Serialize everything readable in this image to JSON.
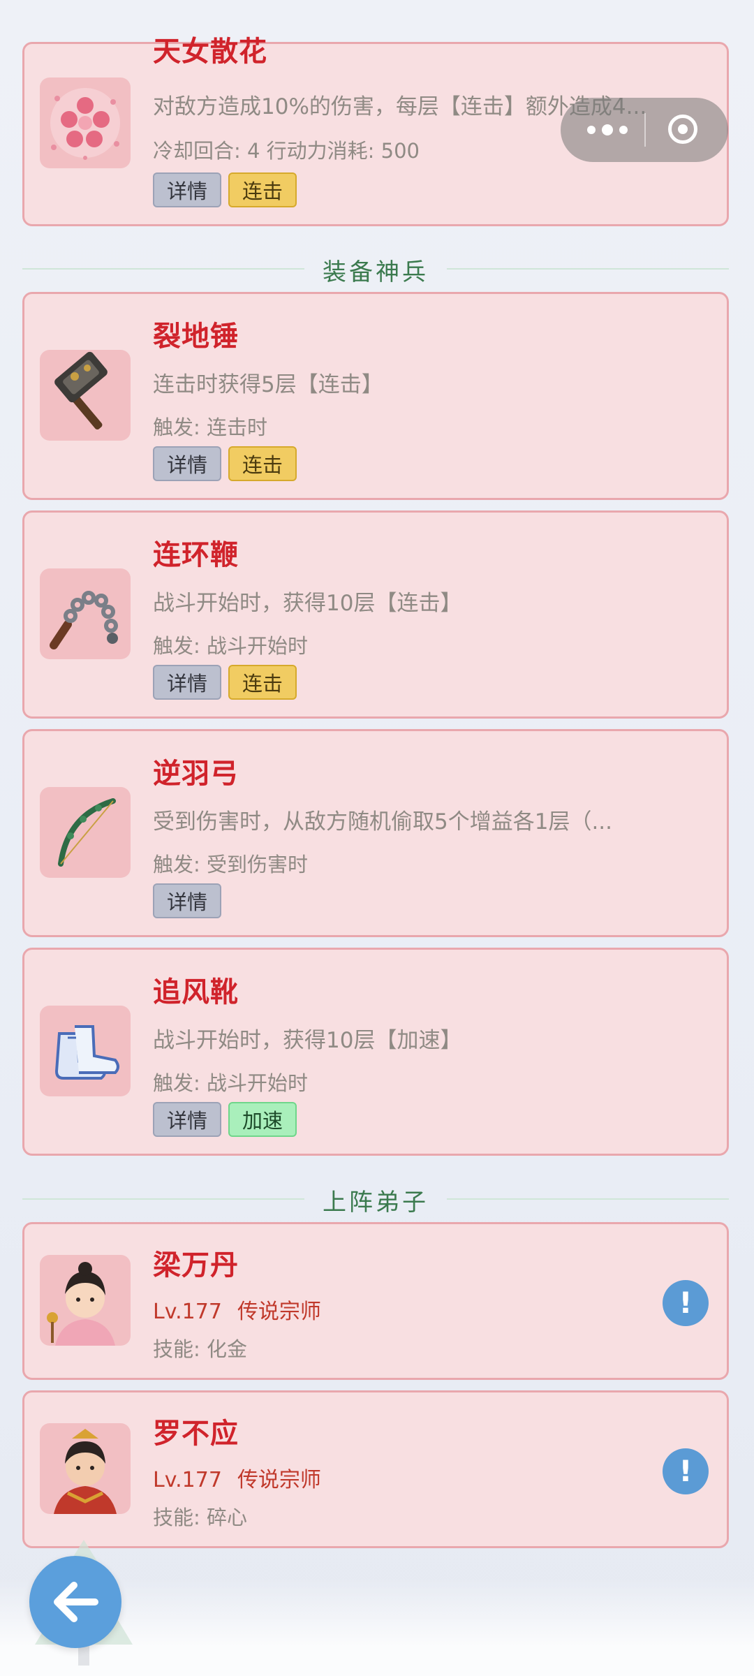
{
  "skill_card": {
    "name": "天女散花",
    "desc": "对敌方造成10%的伤害，每层【连击】额外造成4...",
    "sub": "冷却回合: 4  行动力消耗: 500",
    "tags": [
      "详情",
      "连击"
    ]
  },
  "sections": {
    "equipment": "装备神兵",
    "disciples": "上阵弟子"
  },
  "equipment": [
    {
      "name": "裂地锤",
      "desc": "连击时获得5层【连击】",
      "trigger": "触发: 连击时",
      "tags": [
        "详情",
        "连击"
      ],
      "icon": "hammer-icon"
    },
    {
      "name": "连环鞭",
      "desc": "战斗开始时，获得10层【连击】",
      "trigger": "触发: 战斗开始时",
      "tags": [
        "详情",
        "连击"
      ],
      "icon": "chain-whip-icon"
    },
    {
      "name": "逆羽弓",
      "desc": "受到伤害时，从敌方随机偷取5个增益各1层（...",
      "trigger": "触发: 受到伤害时",
      "tags": [
        "详情"
      ],
      "icon": "bow-icon"
    },
    {
      "name": "追风靴",
      "desc": "战斗开始时，获得10层【加速】",
      "trigger": "触发: 战斗开始时",
      "tags": [
        "详情",
        "加速"
      ],
      "icon": "boots-icon"
    }
  ],
  "disciples": [
    {
      "name": "梁万丹",
      "level": "Lv.177",
      "rank": "传说宗师",
      "skill": "技能: 化金",
      "icon": "disciple-avatar"
    },
    {
      "name": "罗不应",
      "level": "Lv.177",
      "rank": "传说宗师",
      "skill": "技能: 碎心",
      "icon": "disciple-avatar"
    }
  ],
  "alert_glyph": "!",
  "colors": {
    "name_red": "#d0232b",
    "card_bg": "#f8dfe1",
    "card_border": "#e9a7ad",
    "tag_combo": "#f1cc62",
    "tag_speed": "#a9efbb",
    "alert_blue": "#5b9bd5"
  }
}
